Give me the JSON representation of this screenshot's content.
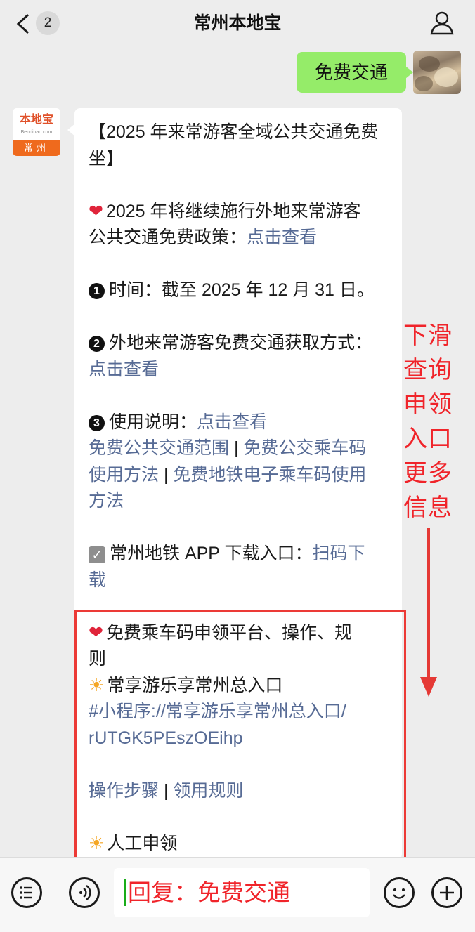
{
  "header": {
    "unread_count": "2",
    "title": "常州本地宝"
  },
  "avatars": {
    "bot_logo_text": "本地宝",
    "bot_logo_sub": "Bendibao.com",
    "bot_city": "常州"
  },
  "messages": {
    "outgoing_text": "免费交通",
    "incoming": {
      "title_line1": "【2025 年来常游客全域公共交通免费",
      "title_line2": "坐】",
      "policy_line1": "2025 年将继续施行外地来常游客",
      "policy_line2_prefix": "公共交通免费政策：",
      "policy_link": "点击查看",
      "time_num": "1",
      "time_text": "时间：截至 2025 年 12 月 31 日。",
      "obtain_num": "2",
      "obtain_text": "外地来常游客免费交通获取方式：",
      "obtain_link": "点击查看",
      "usage_num": "3",
      "usage_prefix": "使用说明：",
      "usage_link": "点击查看",
      "range_link_a": "免费公共交通范围",
      "sep1": " | ",
      "range_link_b1": "免费公交乘车码",
      "range_link_b2": "使用方法",
      "sep2": " | ",
      "range_link_c1": "免费地铁电子乘车码使用",
      "range_link_c2": "方法",
      "metro_prefix": "常州地铁 APP 下载入口：",
      "metro_link_1": "扫码下",
      "metro_link_2": "载",
      "platform_line1": "免费乘车码申领平台、操作、规",
      "platform_line2": "则",
      "entry_text": "常享游乐享常州总入口",
      "mini_link_1": "#小程序://常享游乐享常州总入口/",
      "mini_link_2": "rUTGK5PEszOEihp",
      "steps_link": "操作步骤",
      "sep3": " | ",
      "rules_link": "领用规则",
      "manual_text": "人工申领"
    }
  },
  "annotation": {
    "lines": [
      "下滑",
      "查询",
      "申领",
      "入口",
      "更多",
      "信息"
    ]
  },
  "input": {
    "value": "回复：免费交通"
  },
  "colors": {
    "outgoing_bubble": "#95ec69",
    "link": "#576b95",
    "annotation_red": "#f0242a"
  }
}
